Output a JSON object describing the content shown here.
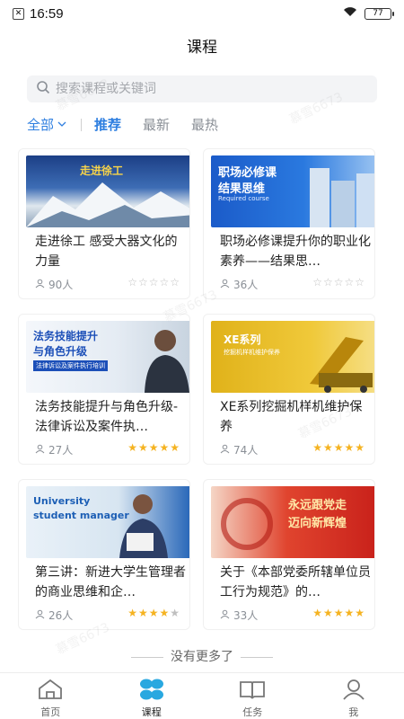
{
  "status": {
    "time": "16:59",
    "battery": "77"
  },
  "header": {
    "title": "课程"
  },
  "search": {
    "placeholder": "搜索课程或关键词"
  },
  "filters": {
    "all": "全部",
    "tabs": [
      "推荐",
      "最新",
      "最热"
    ]
  },
  "courses": [
    {
      "title": "走进徐工 感受大器文化的力量",
      "count": "90人",
      "stars": 0,
      "thumb_text": "走进徐工"
    },
    {
      "title": "职场必修课提升你的职业化素养——结果思…",
      "count": "36人",
      "stars": 0,
      "thumb_text": "职场必修课",
      "thumb_text2": "结果思维",
      "thumb_text3": "Required course"
    },
    {
      "title": "法务技能提升与角色升级-法律诉讼及案件执…",
      "count": "27人",
      "stars": 5,
      "thumb_text": "法务技能提升",
      "thumb_text2": "与角色升级",
      "thumb_text3": "法律诉讼及案件执行培训"
    },
    {
      "title": "XE系列挖掘机样机维护保养",
      "count": "74人",
      "stars": 5,
      "thumb_text": "XE系列",
      "thumb_text2": "挖掘机样机维护保养"
    },
    {
      "title": "第三讲：新进大学生管理者的商业思维和企…",
      "count": "26人",
      "stars": 4,
      "thumb_text": "University",
      "thumb_text2": "student manager"
    },
    {
      "title": "关于《本部党委所辖单位员工行为规范》的…",
      "count": "33人",
      "stars": 5,
      "thumb_text": "永远跟党走",
      "thumb_text2": "迈向新辉煌"
    }
  ],
  "footer": {
    "no_more": "没有更多了"
  },
  "tabbar": {
    "items": [
      "首页",
      "课程",
      "任务",
      "我"
    ]
  },
  "watermark": "慕雪6673",
  "colors": {
    "accent": "#2f7fe0",
    "star": "#f5b321"
  }
}
